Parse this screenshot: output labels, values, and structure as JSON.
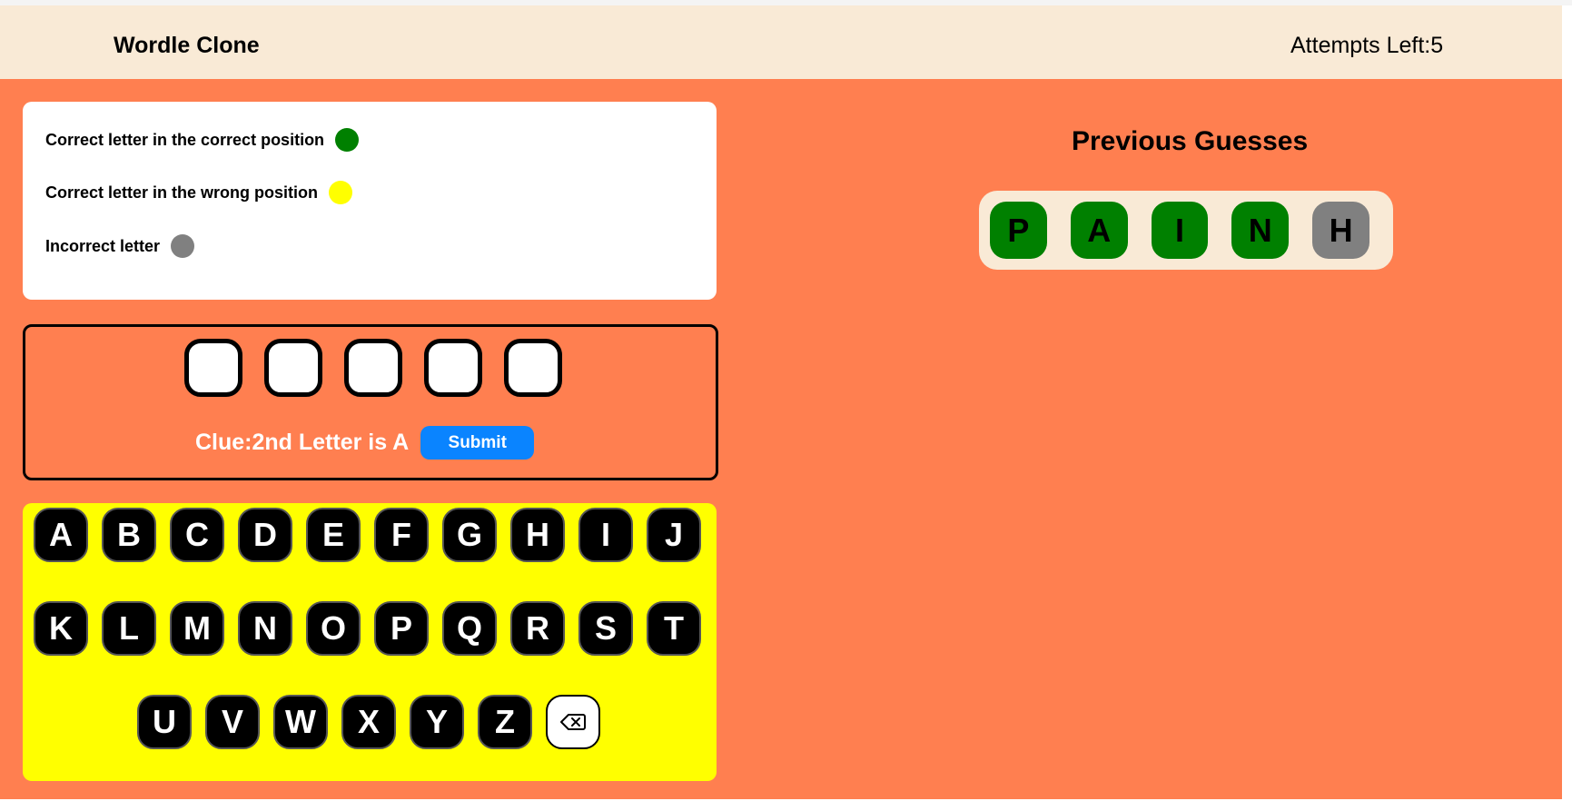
{
  "header": {
    "title": "Wordle Clone",
    "attempts": "Attempts Left:5"
  },
  "legend": {
    "items": [
      {
        "label": "Correct letter in the correct position",
        "color": "#008000"
      },
      {
        "label": "Correct letter in the wrong position",
        "color": "#ffff00"
      },
      {
        "label": "Incorrect letter",
        "color": "#808080"
      }
    ]
  },
  "input": {
    "slots": [
      "",
      "",
      "",
      "",
      ""
    ],
    "clue": "Clue:2nd Letter is A",
    "submit_label": "Submit"
  },
  "keyboard": {
    "row1": [
      "A",
      "B",
      "C",
      "D",
      "E",
      "F",
      "G",
      "H",
      "I",
      "J"
    ],
    "row2": [
      "K",
      "L",
      "M",
      "N",
      "O",
      "P",
      "Q",
      "R",
      "S",
      "T"
    ],
    "row3": [
      "U",
      "V",
      "W",
      "X",
      "Y",
      "Z"
    ],
    "backspace_icon": "backspace-icon"
  },
  "previous": {
    "title": "Previous Guesses",
    "guesses": [
      [
        {
          "letter": "P",
          "color": "#008000"
        },
        {
          "letter": "A",
          "color": "#008000"
        },
        {
          "letter": "I",
          "color": "#008000"
        },
        {
          "letter": "N",
          "color": "#008000"
        },
        {
          "letter": "H",
          "color": "#808080"
        }
      ]
    ]
  },
  "colors": {
    "background": "#ff7f50",
    "header": "#f9ead6",
    "keyboard": "#ffff00",
    "submit": "#0a84ff"
  }
}
